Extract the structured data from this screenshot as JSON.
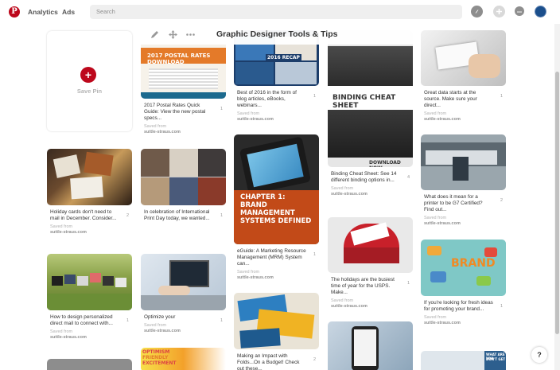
{
  "header": {
    "logo": "P",
    "nav": [
      "Analytics",
      "Ads"
    ],
    "search_placeholder": "Search",
    "help": "?"
  },
  "board": {
    "title": "Graphic Designer Tools & Tips",
    "save_pin_label": "Save Pin",
    "save_from": "Saved from",
    "source": "suttle-straus.com"
  },
  "pins": [
    {
      "desc": "2017 Postal Rates Quick Guide: View the new postal specs...",
      "repins": "1",
      "img_text": "2017 POSTAL RATES DOWNLOAD"
    },
    {
      "desc": "Best of 2016 in the form of blog articles, eBooks, webinars...",
      "repins": "1",
      "img_text": "2016 RECAP"
    },
    {
      "desc": "Binding Cheat Sheet: See 14 different binding options in...",
      "repins": "4",
      "img_text": "BINDING CHEAT SHEET",
      "img_sub": "DOWNLOAD NOW"
    },
    {
      "desc": "Great data starts at the source. Make sure your direct...",
      "repins": "1"
    },
    {
      "desc": "Holiday cards don't need to mail in December. Consider...",
      "repins": "2"
    },
    {
      "desc": "In celebration of International Print Day today, we wanted...",
      "repins": "1"
    },
    {
      "desc": "eGuide: A Marketing Resource Management (MRM) System can...",
      "repins": "1",
      "img_text": "CHAPTER 1: BRAND MANAGEMENT SYSTEMS DEFINED"
    },
    {
      "desc": "What does it mean for a printer to be G7 Certified? Find out...",
      "repins": "2"
    },
    {
      "desc": "The holidays are the busiest time of year for the USPS. Make...",
      "repins": "1"
    },
    {
      "desc": "How to design personalized direct mail to connect with...",
      "repins": "1"
    },
    {
      "desc": "Optimize your",
      "repins": "1"
    },
    {
      "desc": "If you're looking for fresh ideas for promoting your brand...",
      "repins": "1",
      "img_text": "BRAND"
    },
    {
      "desc": "Making an Impact with Folds...On a Budget! Check out these...",
      "repins": "2"
    }
  ],
  "bottom_text": {
    "optimism": "OPTIMISM",
    "friendly": "FRIENDLY",
    "excitement": "EXCITEMENT",
    "what_are": "WHAT ARE YOU",
    "dont_get": "DON'T GET"
  }
}
